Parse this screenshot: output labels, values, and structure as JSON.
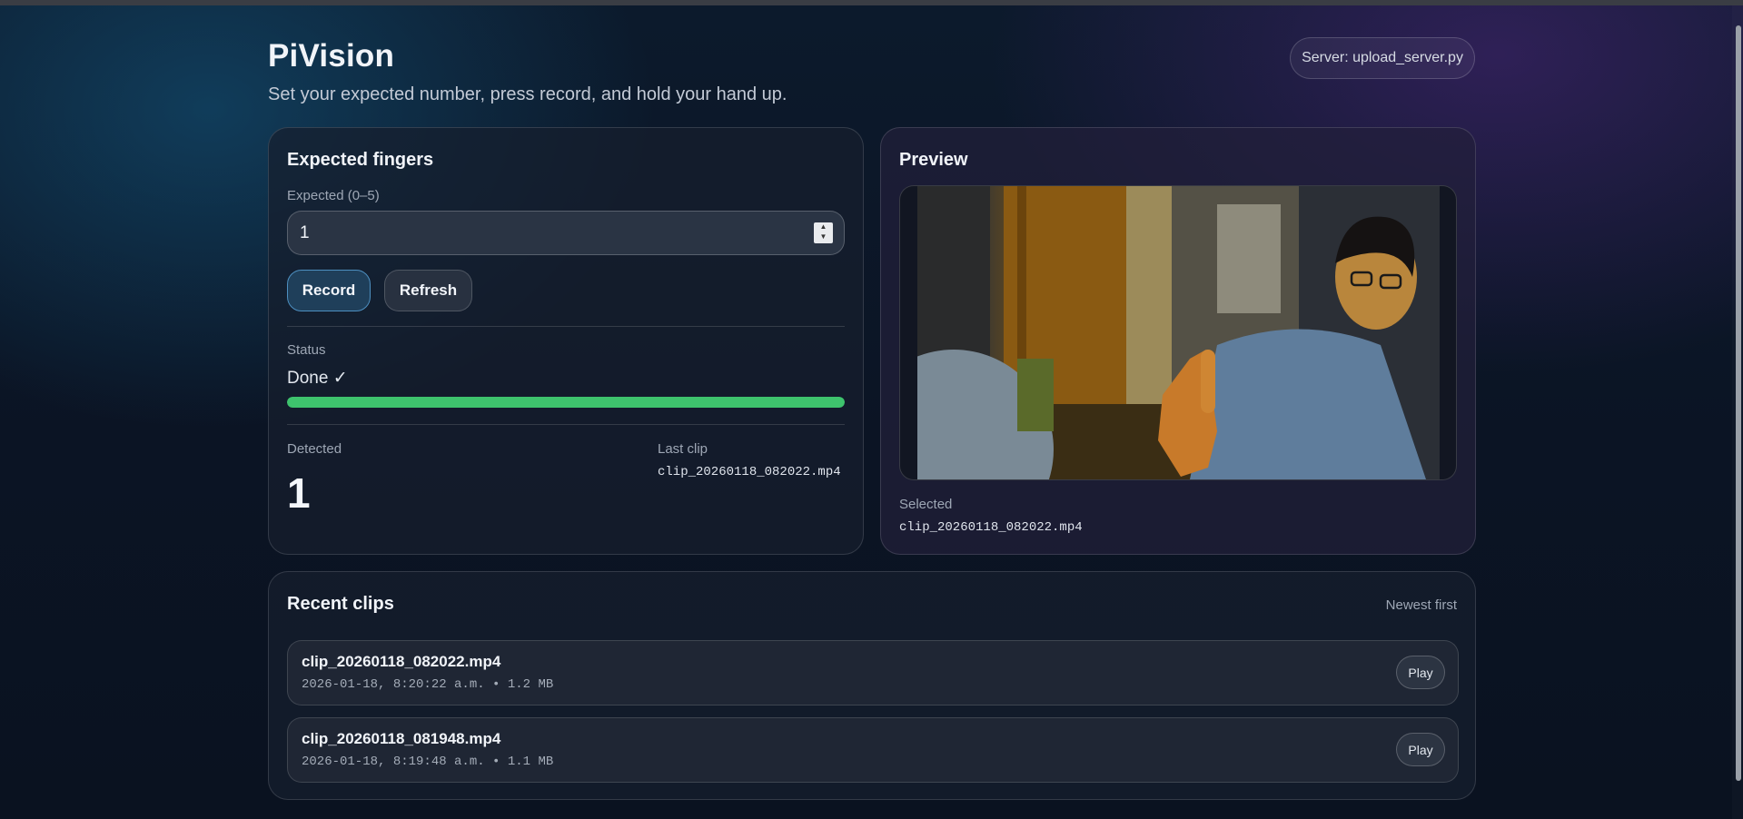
{
  "app": {
    "title": "PiVision",
    "subtitle": "Set your expected number, press record, and hold your hand up.",
    "server_label": "Server: upload_server.py"
  },
  "controls": {
    "card_title": "Expected fingers",
    "expected_label": "Expected (0–5)",
    "expected_value": "1",
    "record_label": "Record",
    "refresh_label": "Refresh",
    "status_label": "Status",
    "status_text": "Done ✓",
    "progress_fraction": 1.0,
    "progress_color": "#3ec36d",
    "detected_label": "Detected",
    "detected_value": "1",
    "last_clip_label": "Last clip",
    "last_clip_value": "clip_20260118_082022.mp4"
  },
  "preview": {
    "card_title": "Preview",
    "selected_label": "Selected",
    "selected_value": "clip_20260118_082022.mp4"
  },
  "recent": {
    "card_title": "Recent clips",
    "sort_label": "Newest first",
    "clips": [
      {
        "name": "clip_20260118_082022.mp4",
        "meta": "2026-01-18, 8:20:22 a.m. • 1.2 MB",
        "play_label": "Play"
      },
      {
        "name": "clip_20260118_081948.mp4",
        "meta": "2026-01-18, 8:19:48 a.m. • 1.1 MB",
        "play_label": "Play"
      }
    ]
  },
  "colors": {
    "accent": "#4d8fc0",
    "success": "#3ec36d",
    "background": "#0b1424"
  }
}
